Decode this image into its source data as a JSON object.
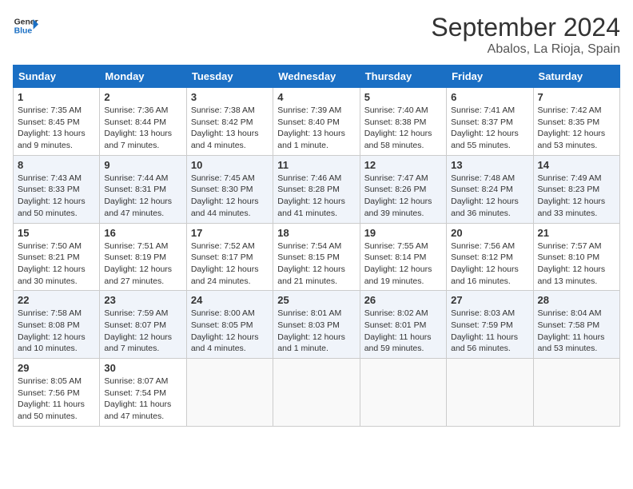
{
  "logo": {
    "line1": "General",
    "line2": "Blue"
  },
  "header": {
    "month": "September 2024",
    "location": "Abalos, La Rioja, Spain"
  },
  "weekdays": [
    "Sunday",
    "Monday",
    "Tuesday",
    "Wednesday",
    "Thursday",
    "Friday",
    "Saturday"
  ],
  "weeks": [
    [
      {
        "day": "1",
        "info": "Sunrise: 7:35 AM\nSunset: 8:45 PM\nDaylight: 13 hours\nand 9 minutes."
      },
      {
        "day": "2",
        "info": "Sunrise: 7:36 AM\nSunset: 8:44 PM\nDaylight: 13 hours\nand 7 minutes."
      },
      {
        "day": "3",
        "info": "Sunrise: 7:38 AM\nSunset: 8:42 PM\nDaylight: 13 hours\nand 4 minutes."
      },
      {
        "day": "4",
        "info": "Sunrise: 7:39 AM\nSunset: 8:40 PM\nDaylight: 13 hours\nand 1 minute."
      },
      {
        "day": "5",
        "info": "Sunrise: 7:40 AM\nSunset: 8:38 PM\nDaylight: 12 hours\nand 58 minutes."
      },
      {
        "day": "6",
        "info": "Sunrise: 7:41 AM\nSunset: 8:37 PM\nDaylight: 12 hours\nand 55 minutes."
      },
      {
        "day": "7",
        "info": "Sunrise: 7:42 AM\nSunset: 8:35 PM\nDaylight: 12 hours\nand 53 minutes."
      }
    ],
    [
      {
        "day": "8",
        "info": "Sunrise: 7:43 AM\nSunset: 8:33 PM\nDaylight: 12 hours\nand 50 minutes."
      },
      {
        "day": "9",
        "info": "Sunrise: 7:44 AM\nSunset: 8:31 PM\nDaylight: 12 hours\nand 47 minutes."
      },
      {
        "day": "10",
        "info": "Sunrise: 7:45 AM\nSunset: 8:30 PM\nDaylight: 12 hours\nand 44 minutes."
      },
      {
        "day": "11",
        "info": "Sunrise: 7:46 AM\nSunset: 8:28 PM\nDaylight: 12 hours\nand 41 minutes."
      },
      {
        "day": "12",
        "info": "Sunrise: 7:47 AM\nSunset: 8:26 PM\nDaylight: 12 hours\nand 39 minutes."
      },
      {
        "day": "13",
        "info": "Sunrise: 7:48 AM\nSunset: 8:24 PM\nDaylight: 12 hours\nand 36 minutes."
      },
      {
        "day": "14",
        "info": "Sunrise: 7:49 AM\nSunset: 8:23 PM\nDaylight: 12 hours\nand 33 minutes."
      }
    ],
    [
      {
        "day": "15",
        "info": "Sunrise: 7:50 AM\nSunset: 8:21 PM\nDaylight: 12 hours\nand 30 minutes."
      },
      {
        "day": "16",
        "info": "Sunrise: 7:51 AM\nSunset: 8:19 PM\nDaylight: 12 hours\nand 27 minutes."
      },
      {
        "day": "17",
        "info": "Sunrise: 7:52 AM\nSunset: 8:17 PM\nDaylight: 12 hours\nand 24 minutes."
      },
      {
        "day": "18",
        "info": "Sunrise: 7:54 AM\nSunset: 8:15 PM\nDaylight: 12 hours\nand 21 minutes."
      },
      {
        "day": "19",
        "info": "Sunrise: 7:55 AM\nSunset: 8:14 PM\nDaylight: 12 hours\nand 19 minutes."
      },
      {
        "day": "20",
        "info": "Sunrise: 7:56 AM\nSunset: 8:12 PM\nDaylight: 12 hours\nand 16 minutes."
      },
      {
        "day": "21",
        "info": "Sunrise: 7:57 AM\nSunset: 8:10 PM\nDaylight: 12 hours\nand 13 minutes."
      }
    ],
    [
      {
        "day": "22",
        "info": "Sunrise: 7:58 AM\nSunset: 8:08 PM\nDaylight: 12 hours\nand 10 minutes."
      },
      {
        "day": "23",
        "info": "Sunrise: 7:59 AM\nSunset: 8:07 PM\nDaylight: 12 hours\nand 7 minutes."
      },
      {
        "day": "24",
        "info": "Sunrise: 8:00 AM\nSunset: 8:05 PM\nDaylight: 12 hours\nand 4 minutes."
      },
      {
        "day": "25",
        "info": "Sunrise: 8:01 AM\nSunset: 8:03 PM\nDaylight: 12 hours\nand 1 minute."
      },
      {
        "day": "26",
        "info": "Sunrise: 8:02 AM\nSunset: 8:01 PM\nDaylight: 11 hours\nand 59 minutes."
      },
      {
        "day": "27",
        "info": "Sunrise: 8:03 AM\nSunset: 7:59 PM\nDaylight: 11 hours\nand 56 minutes."
      },
      {
        "day": "28",
        "info": "Sunrise: 8:04 AM\nSunset: 7:58 PM\nDaylight: 11 hours\nand 53 minutes."
      }
    ],
    [
      {
        "day": "29",
        "info": "Sunrise: 8:05 AM\nSunset: 7:56 PM\nDaylight: 11 hours\nand 50 minutes."
      },
      {
        "day": "30",
        "info": "Sunrise: 8:07 AM\nSunset: 7:54 PM\nDaylight: 11 hours\nand 47 minutes."
      },
      null,
      null,
      null,
      null,
      null
    ]
  ]
}
